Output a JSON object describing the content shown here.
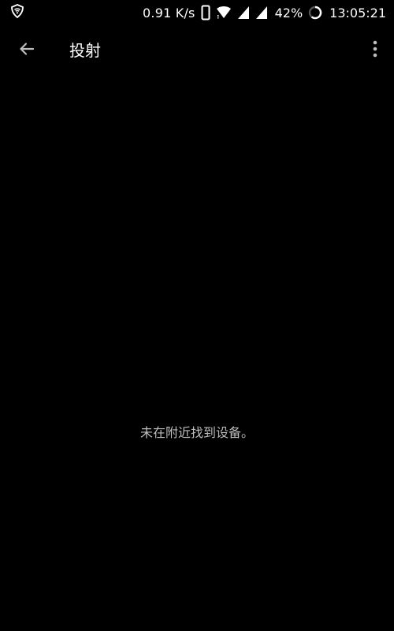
{
  "status_bar": {
    "net_speed": "0.91 K/s",
    "battery_percent": "42%",
    "time": "13:05:21",
    "icons": [
      "vpn-shield-icon",
      "phone-icon",
      "wifi-icon",
      "signal-icon",
      "signal-icon",
      "battery-ring-icon"
    ]
  },
  "toolbar": {
    "title": "投射",
    "back_icon": "arrow-back-icon",
    "more_icon": "more-vert-icon"
  },
  "main": {
    "empty_message": "未在附近找到设备。"
  },
  "colors": {
    "background": "#000000",
    "text_primary": "#ffffff",
    "text_secondary": "#bdbdbd",
    "icon": "#bdbdbd"
  }
}
